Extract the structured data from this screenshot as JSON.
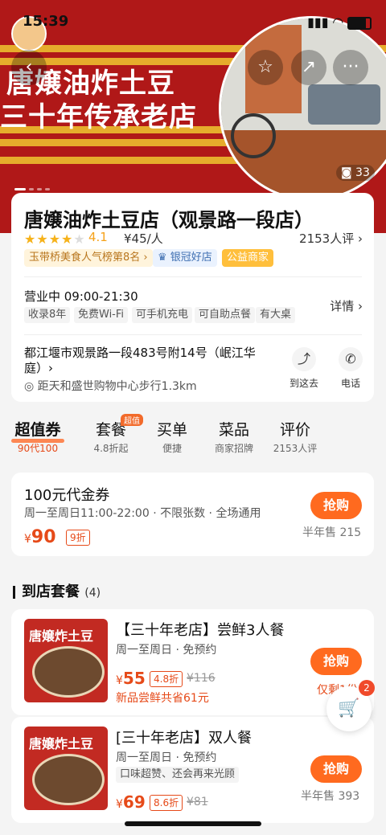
{
  "status_bar": {
    "time": "15:39"
  },
  "hero": {
    "title_line1": "唐嬢油炸土豆",
    "title_line2": "三十年传承老店",
    "photo_count": "33"
  },
  "icons": {
    "back": "back-icon",
    "favorite": "star-icon",
    "share": "share-icon",
    "more": "more-icon"
  },
  "shop": {
    "name": "唐嬢油炸土豆店（观景路一段店）",
    "rating": "4.1",
    "rating_value": 4.1,
    "price_per_person": "¥45/人",
    "review_count": "2153人评 ›",
    "tags": [
      "玉带桥美食人气榜第8名 ›",
      "银冠好店",
      "公益商家"
    ],
    "hours": "营业中 09:00-21:30",
    "features": [
      "收录8年",
      "免费Wi-Fi",
      "可手机充电",
      "可自助点餐",
      "有大桌"
    ],
    "details_label": "详情 ›",
    "address": "都江堰市观景路一段483号附14号（岷江华庭）›",
    "distance": "距天和盛世购物中心步行1.3km",
    "actions": {
      "navigate": "到这去",
      "call": "电话"
    }
  },
  "tabs": [
    {
      "label": "超值券",
      "sub": "90代100"
    },
    {
      "label": "套餐",
      "sub": "4.8折起",
      "badge": "超值"
    },
    {
      "label": "买单",
      "sub": "便捷"
    },
    {
      "label": "菜品",
      "sub": "商家招牌"
    },
    {
      "label": "评价",
      "sub": "2153人评"
    }
  ],
  "coupon": {
    "title": "100元代金券",
    "subtitle": "周一至周日11:00-22:00 · 不限张数 · 全场通用",
    "currency": "¥",
    "price": "90",
    "discount": "9折",
    "buy_label": "抢购",
    "sold": "半年售 215"
  },
  "packages_section": {
    "title": "到店套餐",
    "count": "(4)"
  },
  "packages": [
    {
      "image_text": "唐嬢炸土豆",
      "name": "【三十年老店】尝鲜3人餐",
      "subtitle": "周一至周日 · 免预约",
      "currency": "¥",
      "price": "55",
      "discount": "4.8折",
      "original": "¥116",
      "note": "新品尝鲜共省61元",
      "buy_label": "抢购",
      "stock": "仅剩1份"
    },
    {
      "image_text": "唐嬢炸土豆",
      "name": "[三十年老店】双人餐",
      "subtitle": "周一至周日 · 免预约",
      "chip": "口味超赞、还会再来光顾",
      "currency": "¥",
      "price": "69",
      "discount": "8.6折",
      "original": "¥81",
      "buy_label": "抢购",
      "sold": "半年售 393"
    }
  ],
  "cart": {
    "badge": "2"
  },
  "colors": {
    "brand": "#ff6a1f",
    "hero_red": "#b01818",
    "price_red": "#e64a19",
    "gold": "#e6ac2c"
  }
}
